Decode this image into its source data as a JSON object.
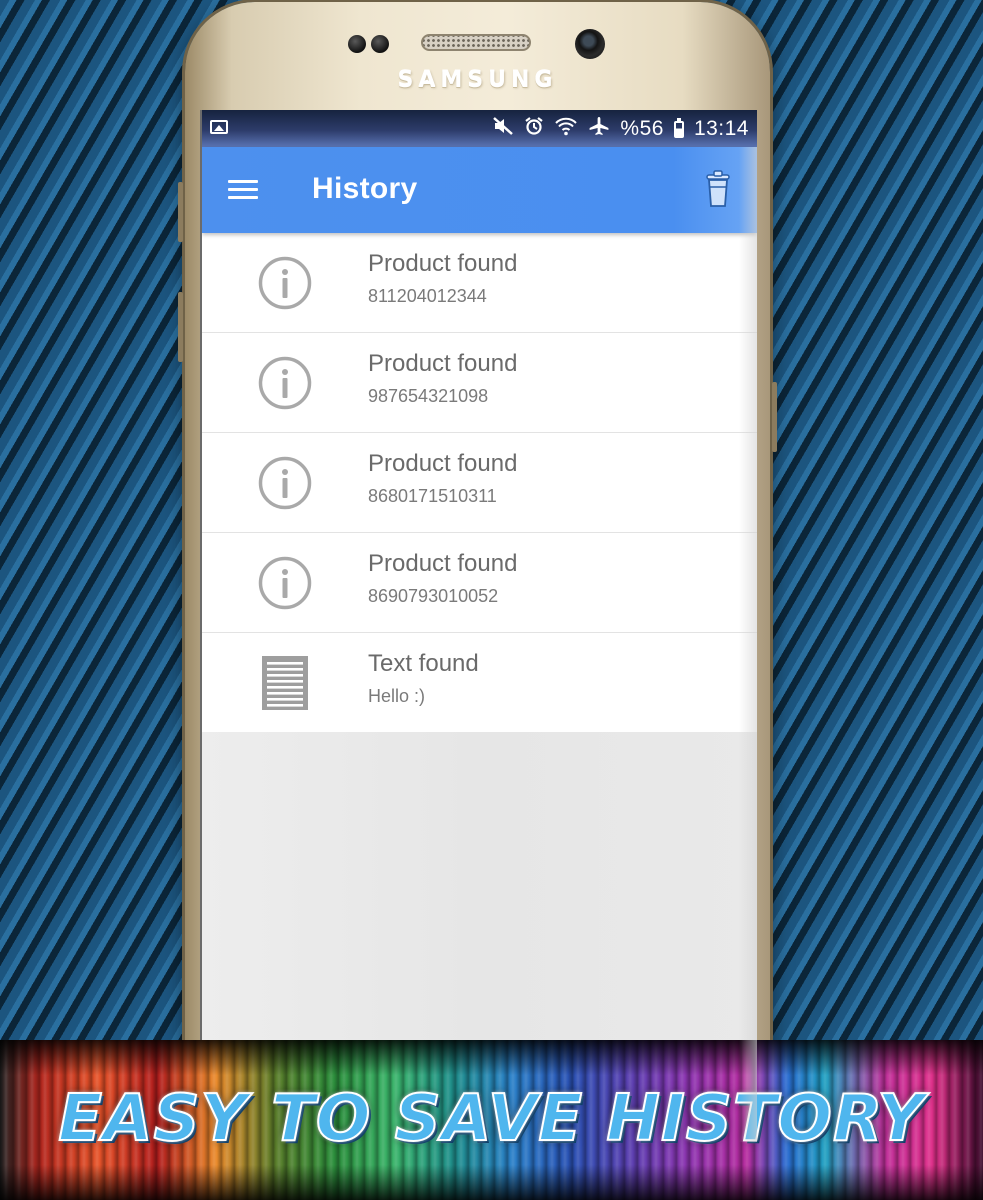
{
  "device": {
    "brand": "SAMSUNG"
  },
  "status_bar": {
    "left_icon": "image-notification-icon",
    "icons": [
      "mute-icon",
      "alarm-icon",
      "wifi-icon",
      "airplane-icon"
    ],
    "battery_text": "%56",
    "battery_level": 0.56,
    "time": "13:14"
  },
  "app_bar": {
    "title": "History",
    "menu_icon": "hamburger-menu-icon",
    "action_icon": "trash-icon",
    "color": "#4a8ff0"
  },
  "history": {
    "items": [
      {
        "icon": "info-icon",
        "title": "Product found",
        "subtitle": "811204012344"
      },
      {
        "icon": "info-icon",
        "title": "Product found",
        "subtitle": "987654321098"
      },
      {
        "icon": "info-icon",
        "title": "Product found",
        "subtitle": "8680171510311"
      },
      {
        "icon": "info-icon",
        "title": "Product found",
        "subtitle": "8690793010052"
      },
      {
        "icon": "text-document-icon",
        "title": "Text found",
        "subtitle": "Hello :)"
      }
    ]
  },
  "banner": {
    "text": "EASY TO SAVE HISTORY"
  }
}
